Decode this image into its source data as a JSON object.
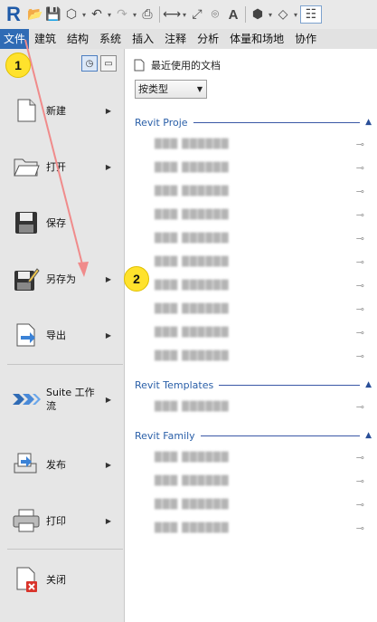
{
  "qat": {
    "app_logo": "R",
    "icons": [
      "open-icon",
      "save-icon",
      "sync-icon",
      "undo-icon",
      "redo-icon",
      "print-icon",
      "measure-icon",
      "dimension-icon",
      "tag-icon",
      "text-icon",
      "3d-view-icon",
      "visibility-icon",
      "switch-windows-icon"
    ]
  },
  "tabs": [
    "文件",
    "建筑",
    "结构",
    "系统",
    "插入",
    "注释",
    "分析",
    "体量和场地",
    "协作"
  ],
  "menu": {
    "items": [
      {
        "label": "新建",
        "has_submenu": true
      },
      {
        "label": "打开",
        "has_submenu": true
      },
      {
        "label": "保存",
        "has_submenu": false
      },
      {
        "label": "另存为",
        "has_submenu": true
      },
      {
        "label": "导出",
        "has_submenu": true
      },
      {
        "label": "Suite 工作流",
        "has_submenu": true
      },
      {
        "label": "发布",
        "has_submenu": true
      },
      {
        "label": "打印",
        "has_submenu": true
      },
      {
        "label": "关闭",
        "has_submenu": false
      }
    ]
  },
  "recent": {
    "title": "最近使用的文档",
    "sort_value": "按类型",
    "groups": [
      {
        "name": "Revit Proje",
        "count": 10
      },
      {
        "name": "Revit Templates",
        "count": 1
      },
      {
        "name": "Revit Family",
        "count": 4
      }
    ],
    "blurred_placeholder": "███ ██████"
  },
  "callouts": {
    "one": "1",
    "two": "2"
  },
  "colors": {
    "file_tab": "#2f6bb5",
    "callout": "#ffe22c",
    "arrow": "#f08080",
    "group_line": "#3a58a6"
  }
}
